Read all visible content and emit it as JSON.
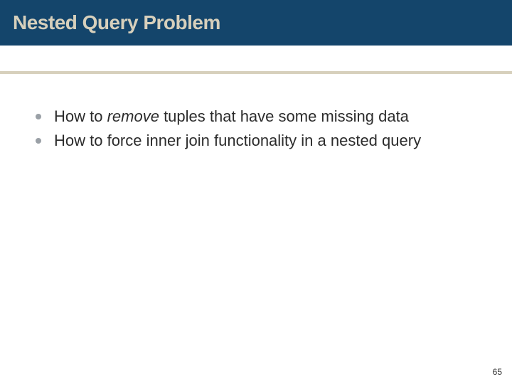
{
  "header": {
    "title": "Nested Query Problem"
  },
  "content": {
    "bullets": [
      {
        "prefix": "How to ",
        "emphasis": "remove",
        "suffix": " tuples that have some missing data"
      },
      {
        "prefix": "How to force inner join functionality in a nested query",
        "emphasis": "",
        "suffix": ""
      }
    ]
  },
  "footer": {
    "page_number": "65"
  }
}
